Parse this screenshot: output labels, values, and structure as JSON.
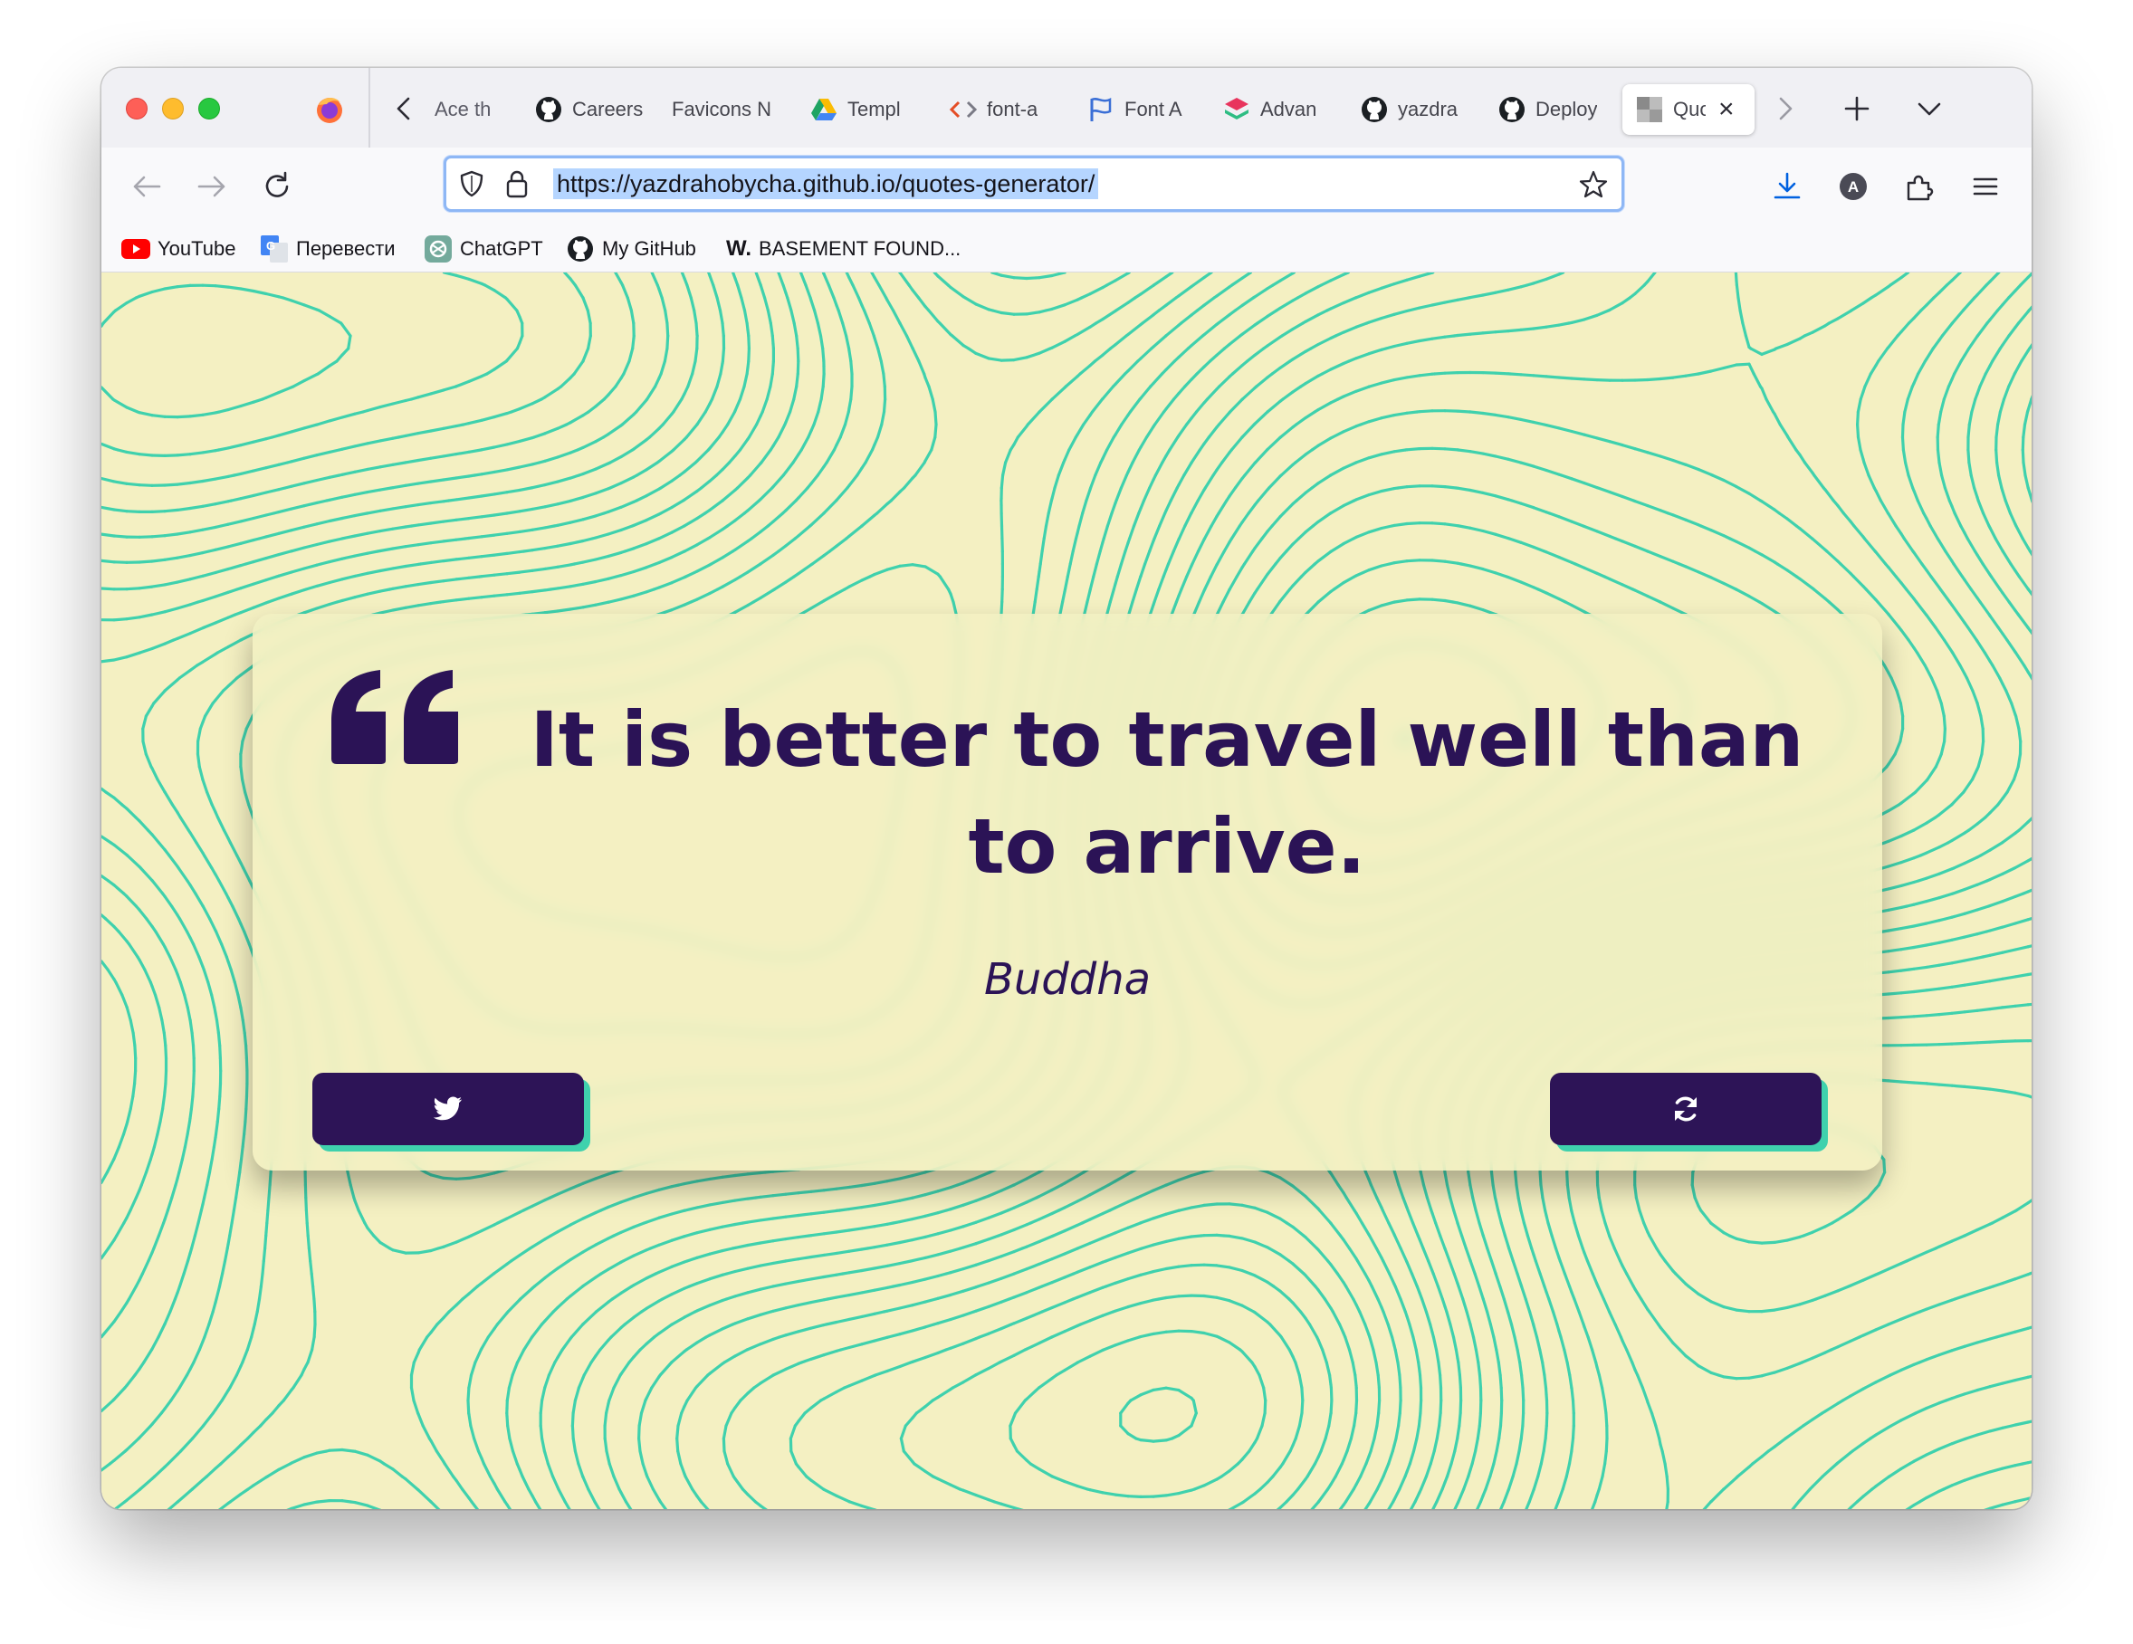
{
  "browser": {
    "tabs": [
      {
        "label": "Ace th",
        "icon": "firefox-tab-icon"
      },
      {
        "label": "Careers",
        "icon": "github-icon"
      },
      {
        "label": "Favicons N",
        "icon": "none"
      },
      {
        "label": "Templ",
        "icon": "google-drive-icon"
      },
      {
        "label": "font-a",
        "icon": "code-brackets-icon"
      },
      {
        "label": "Font A",
        "icon": "flag-icon"
      },
      {
        "label": "Advan",
        "icon": "layers-icon"
      },
      {
        "label": "yazdra",
        "icon": "github-icon"
      },
      {
        "label": "Deploy",
        "icon": "github-icon"
      },
      {
        "label": "Quo",
        "icon": "page-thumbnail-icon",
        "active": true
      }
    ],
    "url": "https://yazdrahobycha.github.io/quotes-generator/",
    "profile_initial": "A",
    "bookmarks": [
      {
        "label": "YouTube",
        "icon": "youtube-icon"
      },
      {
        "label": "Перевести",
        "icon": "google-translate-icon"
      },
      {
        "label": "ChatGPT",
        "icon": "chatgpt-icon"
      },
      {
        "label": "My GitHub",
        "icon": "github-icon"
      },
      {
        "label": "BASEMENT FOUND...",
        "icon": "w-logo-icon",
        "prefix": "W."
      }
    ]
  },
  "quote": {
    "text": "It is better to travel well than to arrive.",
    "author": "Buddha"
  },
  "buttons": {
    "tweet_icon": "twitter-icon",
    "new_quote_icon": "refresh-icon"
  },
  "colors": {
    "page_background": "#f4f0c2",
    "topo_lines": "#3fd1ad",
    "text_primary": "#2b1356",
    "button_bg": "#2d1457",
    "button_shadow": "#3fd1ad"
  }
}
